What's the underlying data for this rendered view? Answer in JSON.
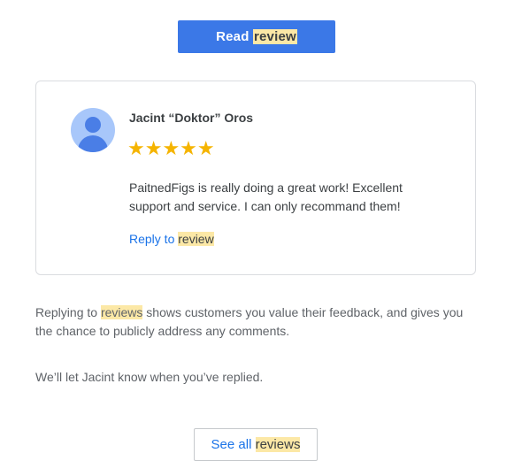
{
  "read_button": {
    "text": "Read ",
    "highlight": "review"
  },
  "review": {
    "reviewer_name": "Jacint “Doktor” Oros",
    "stars": "★★★★★",
    "rating": 5,
    "text": "PaitnedFigs is really doing a great work! Excellent support and service. I can only recommand them!",
    "reply_link": {
      "text": "Reply to ",
      "highlight": "review"
    }
  },
  "paragraph1": {
    "before": "Replying to ",
    "highlight": "reviews",
    "after": " shows customers you value their feedback, and gives you the chance to publicly address any comments."
  },
  "paragraph2": "We’ll let Jacint know when you’ve replied.",
  "see_all_button": {
    "text": "See all ",
    "highlight": "reviews"
  },
  "colors": {
    "primary_button": "#3b78e7",
    "link": "#1a73e8",
    "star": "#f5b400",
    "highlight": "#fce8a6"
  }
}
